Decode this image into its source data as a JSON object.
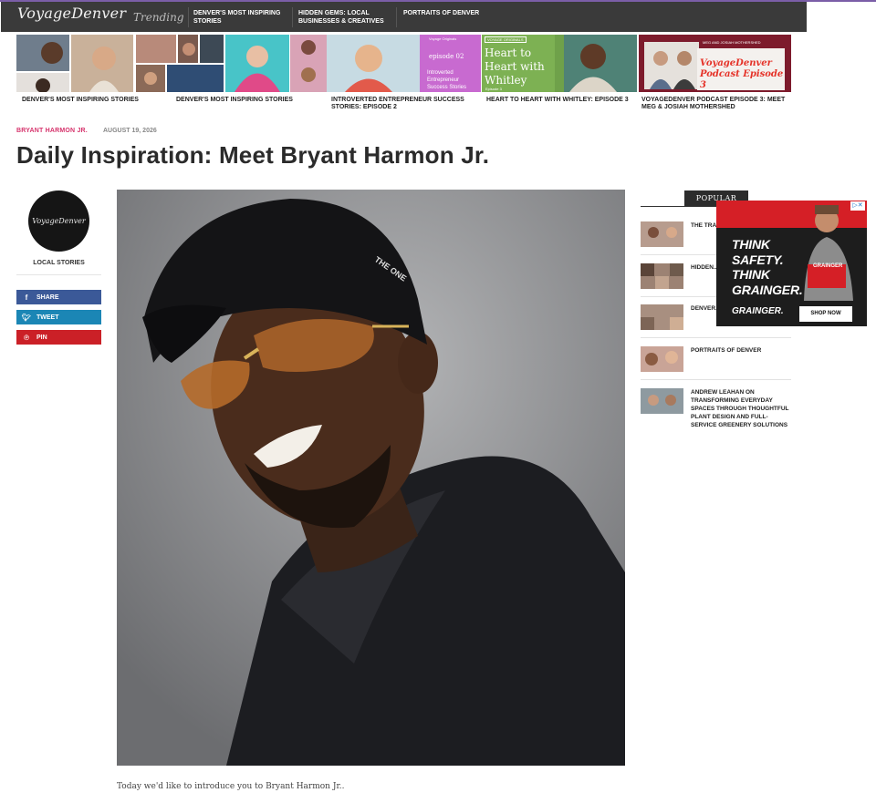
{
  "site": {
    "logo": "VoyageDenver",
    "trending_label": "Trending",
    "trending": [
      "DENVER'S MOST INSPIRING STORIES",
      "HIDDEN GEMS: LOCAL BUSINESSES & CREATIVES",
      "PORTRAITS OF DENVER"
    ]
  },
  "strip": [
    {
      "caption": "DENVER'S MOST INSPIRING STORIES"
    },
    {
      "caption": "DENVER'S MOST INSPIRING STORIES"
    },
    {
      "caption": "INTROVERTED ENTREPRENEUR SUCCESS STORIES: EPISODE 2",
      "overlay_small": "Voyage Originals",
      "overlay_ep": "episode 02",
      "overlay_title": "Introverted Entrepreneur Success Stories"
    },
    {
      "caption": "HEART TO HEART WITH WHITLEY: EPISODE 3",
      "overlay_badge": "VOYAGE ORIGINALS",
      "overlay_title": "Heart to Heart with Whitley",
      "overlay_ep": "Episode 3"
    },
    {
      "caption": "VOYAGEDENVER PODCAST EPISODE 3: MEET MEG & JOSIAH MOTHERSHED",
      "overlay_small": "MEG AND JOSIAH MOTHERSHED",
      "overlay_title": "VoyageDenver Podcast Episode 3"
    }
  ],
  "article": {
    "author": "BRYANT HARMON JR.",
    "date": "AUGUST 19, 2026",
    "title": "Daily Inspiration: Meet Bryant Harmon Jr.",
    "intro": "Today we'd like to introduce you to Bryant Harmon Jr..",
    "hero_cap_text": "THE ONE"
  },
  "sidebar_left": {
    "avatar_text": "VoyageDenver",
    "avatar_label": "LOCAL STORIES",
    "share": "SHARE",
    "tweet": "TWEET",
    "pin": "PIN"
  },
  "popular": {
    "label": "POPULAR",
    "items": [
      {
        "title": "THE TRA... REWRIT..."
      },
      {
        "title": "HIDDEN... BUSINE... SHOULL..."
      },
      {
        "title": "DENVER... STORIES"
      },
      {
        "title": "PORTRAITS OF DENVER"
      },
      {
        "title": "ANDREW LEAHAN ON TRANSFORMING EVERYDAY SPACES THROUGH THOUGHTFUL PLANT DESIGN AND FULL-SERVICE GREENERY SOLUTIONS"
      }
    ]
  },
  "ad": {
    "headline_1": "THINK",
    "headline_2": "SAFETY.",
    "headline_3": "THINK",
    "headline_4": "GRAINGER.",
    "brand": "GRAINGER.",
    "shirt_text": "GRAINGER",
    "cta": "SHOP NOW",
    "choices": "▷✕"
  },
  "colors": {
    "topbar": "#3a3a3a",
    "author_pink": "#d6336c",
    "facebook": "#3b5998",
    "twitter": "#1b86b5",
    "pinterest": "#cb2027",
    "ad_red": "#d51f26"
  }
}
